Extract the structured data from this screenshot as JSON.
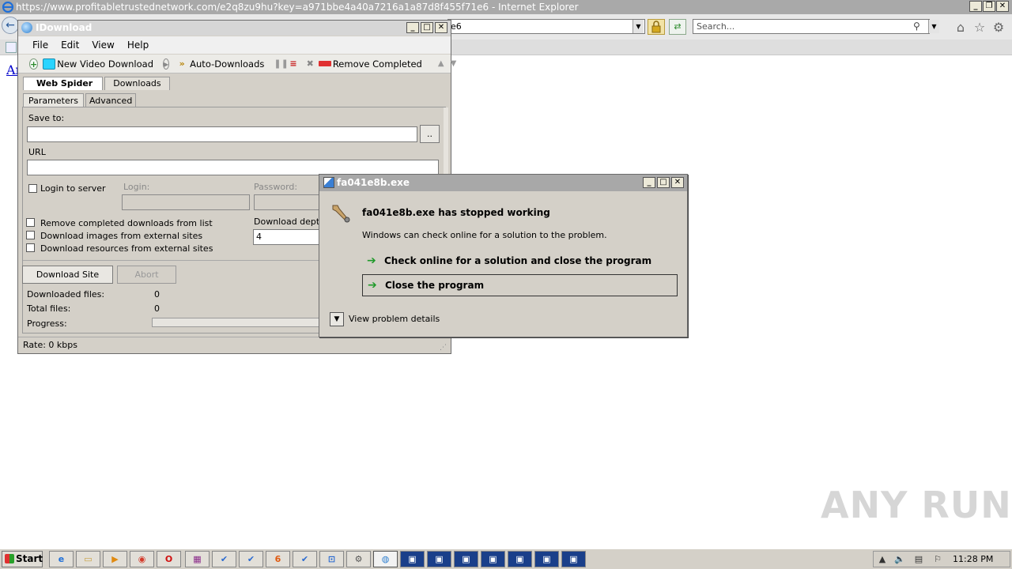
{
  "browser": {
    "title": "https://www.profitabletrustednetwork.com/e2q8zu9hu?key=a971bbe4a40a7216a1a87d8f455f71e6 - Internet Explorer",
    "address_fragment": "e6",
    "search_placeholder": "Search...",
    "page_link_fragment": "Ar"
  },
  "idownload": {
    "title": "IDownload",
    "menu": [
      "File",
      "Edit",
      "View",
      "Help"
    ],
    "toolbar": {
      "new_video": "New Video Download",
      "auto_downloads": "Auto-Downloads",
      "remove_completed": "Remove Completed"
    },
    "main_tabs": [
      "Web Spider",
      "Downloads"
    ],
    "sub_tabs": [
      "Parameters",
      "Advanced"
    ],
    "save_to_label": "Save to:",
    "browse_label": "..",
    "url_label": "URL",
    "login_server_label": "Login to server",
    "login_label": "Login:",
    "password_label": "Password:",
    "options": [
      "Remove completed downloads from list",
      "Download images from external sites",
      "Download resources from external sites"
    ],
    "depth_label": "Download depth",
    "depth_value": "4",
    "download_site_btn": "Download Site",
    "abort_btn": "Abort",
    "downloaded_files_label": "Downloaded files:",
    "downloaded_files_value": "0",
    "total_files_label": "Total files:",
    "total_files_value": "0",
    "progress_label": "Progress:",
    "progress_value": 0,
    "rate": "Rate:  0 kbps"
  },
  "dialog": {
    "title": "fa041e8b.exe",
    "heading": "fa041e8b.exe has stopped working",
    "sub": "Windows can check online for a solution to the problem.",
    "option1": "Check online for a solution and close the program",
    "option2": "Close the program",
    "details": "View problem details"
  },
  "watermark": "ANY RUN",
  "taskbar": {
    "start": "Start",
    "clock": "11:28 PM"
  }
}
